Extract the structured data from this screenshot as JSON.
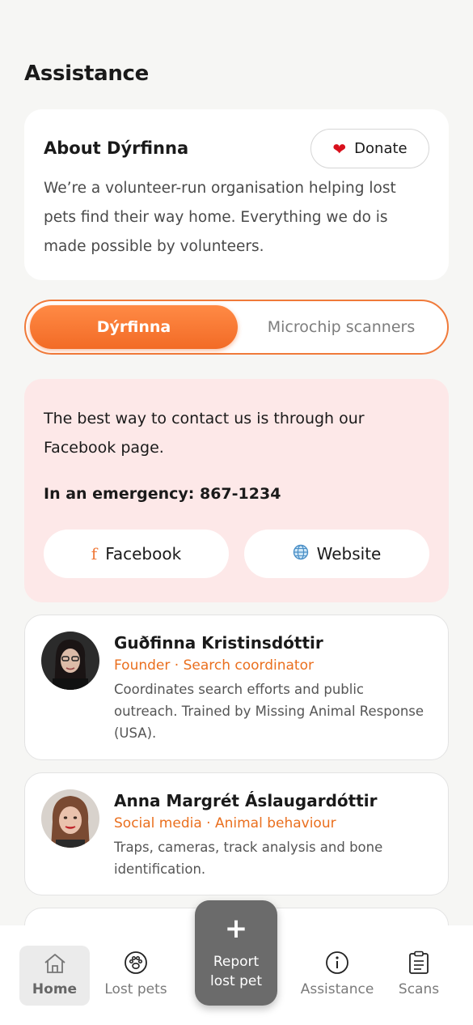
{
  "header": {
    "title": "Assistance"
  },
  "about": {
    "title": "About Dýrfinna",
    "donate_label": "Donate",
    "description": "We’re a volunteer-run organisation helping lost pets find their way home. Everything we do is made possible by volunteers."
  },
  "tabs": {
    "active": "Dýrfinna",
    "inactive": "Microchip scanners"
  },
  "contact": {
    "text": "The best way to contact us is through our Facebook page.",
    "emergency": "In an emergency: 867-1234",
    "facebook_label": "Facebook",
    "website_label": "Website"
  },
  "team": [
    {
      "name": "Guðfinna Kristinsdóttir",
      "role": "Founder · Search coordinator",
      "bio": "Coordinates search efforts and public outreach. Trained by Missing Animal Response (USA)."
    },
    {
      "name": "Anna Margrét Áslaugardóttir",
      "role": "Social media · Animal behaviour",
      "bio": "Traps, cameras, track analysis and bone identification."
    }
  ],
  "nav": {
    "home": "Home",
    "lost_pets": "Lost pets",
    "report_line1": "Report",
    "report_line2": "lost pet",
    "assistance": "Assistance",
    "scans": "Scans"
  },
  "colors": {
    "accent": "#f26b26",
    "role_text": "#ea6f1e",
    "contact_bg": "#fde8e8",
    "heart": "#d8101c"
  },
  "icons": [
    "heart-icon",
    "facebook-icon",
    "globe-icon",
    "home-icon",
    "paw-icon",
    "plus-icon",
    "info-icon",
    "clipboard-icon"
  ]
}
